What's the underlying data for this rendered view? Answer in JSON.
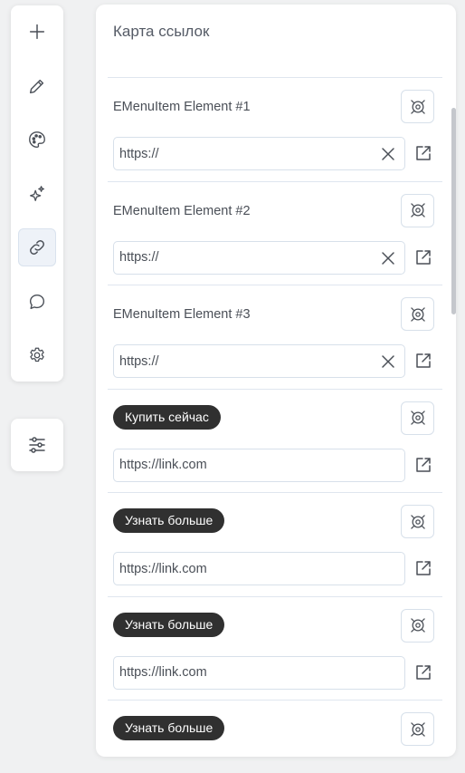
{
  "panel": {
    "title": "Карта ссылок"
  },
  "rail": {
    "items": [
      {
        "icon": "plus-icon"
      },
      {
        "icon": "pencil-icon"
      },
      {
        "icon": "palette-icon"
      },
      {
        "icon": "sparkles-icon"
      },
      {
        "icon": "link-icon",
        "active": true
      },
      {
        "icon": "chat-bubble-icon"
      },
      {
        "icon": "gear-icon"
      }
    ],
    "bottom_icon": "sliders-icon"
  },
  "links": [
    {
      "label": "EMenuItem Element #1",
      "style": "text",
      "url": "https://",
      "clearable": true
    },
    {
      "label": "EMenuItem Element #2",
      "style": "text",
      "url": "https://",
      "clearable": true
    },
    {
      "label": "EMenuItem Element #3",
      "style": "text",
      "url": "https://",
      "clearable": true
    },
    {
      "label": "Купить сейчас",
      "style": "pill",
      "url": "https://link.com",
      "clearable": false
    },
    {
      "label": "Узнать больше",
      "style": "pill",
      "url": "https://link.com",
      "clearable": false
    },
    {
      "label": "Узнать больше",
      "style": "pill",
      "url": "https://link.com",
      "clearable": false
    },
    {
      "label": "Узнать больше",
      "style": "pill",
      "url": "",
      "clearable": false
    }
  ],
  "colors": {
    "background": "#f0f1f2",
    "pill": "#303030",
    "border": "#d7e0ea",
    "active_rail": "#eef2f8"
  }
}
